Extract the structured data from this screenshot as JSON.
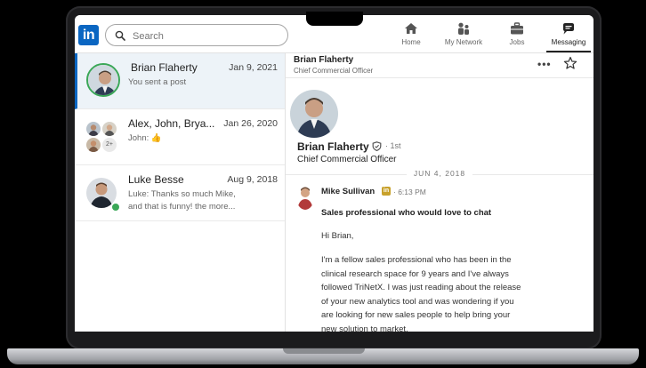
{
  "topnav": {
    "logo_text": "in",
    "search_placeholder": "Search",
    "items": [
      {
        "label": "Home",
        "icon": "home-icon"
      },
      {
        "label": "My Network",
        "icon": "network-icon"
      },
      {
        "label": "Jobs",
        "icon": "briefcase-icon"
      },
      {
        "label": "Messaging",
        "icon": "messaging-icon",
        "active": true
      }
    ]
  },
  "conversations": [
    {
      "name": "Brian Flaherty",
      "date": "Jan 9, 2021",
      "snippet": "You sent a post",
      "selected": true
    },
    {
      "name": "Alex, John, Brya...",
      "date": "Jan 26, 2020",
      "snippet": "John: 👍",
      "group_count": "2+"
    },
    {
      "name": "Luke Besse",
      "date": "Aug 9, 2018",
      "snippet_line1": "Luke: Thanks so much Mike,",
      "snippet_line2": "and that is funny! the more..."
    }
  ],
  "chat": {
    "header_name": "Brian Flaherty",
    "header_title": "Chief Commercial Officer",
    "more_label": "•••",
    "profile_name": "Brian Flaherty",
    "profile_degree": "· 1st",
    "profile_title": "Chief Commercial Officer",
    "date_separator": "JUN 4, 2018",
    "message": {
      "author": "Mike Sullivan",
      "badge": "in",
      "time": "· 6:13 PM",
      "subject": "Sales professional who would love to chat",
      "greeting": "Hi Brian,",
      "body_lines": [
        "I'm a fellow sales professional who has been in the",
        "clinical research space for 9 years and I've always",
        "followed TriNetX. I was just reading about the release",
        "of your new analytics tool and was wondering if you",
        "are looking for new sales people to help bring your",
        "new solution to market."
      ]
    }
  },
  "colors": {
    "brand": "#0a66c2",
    "selected_bg": "#edf3f8",
    "online": "#3aa757"
  }
}
